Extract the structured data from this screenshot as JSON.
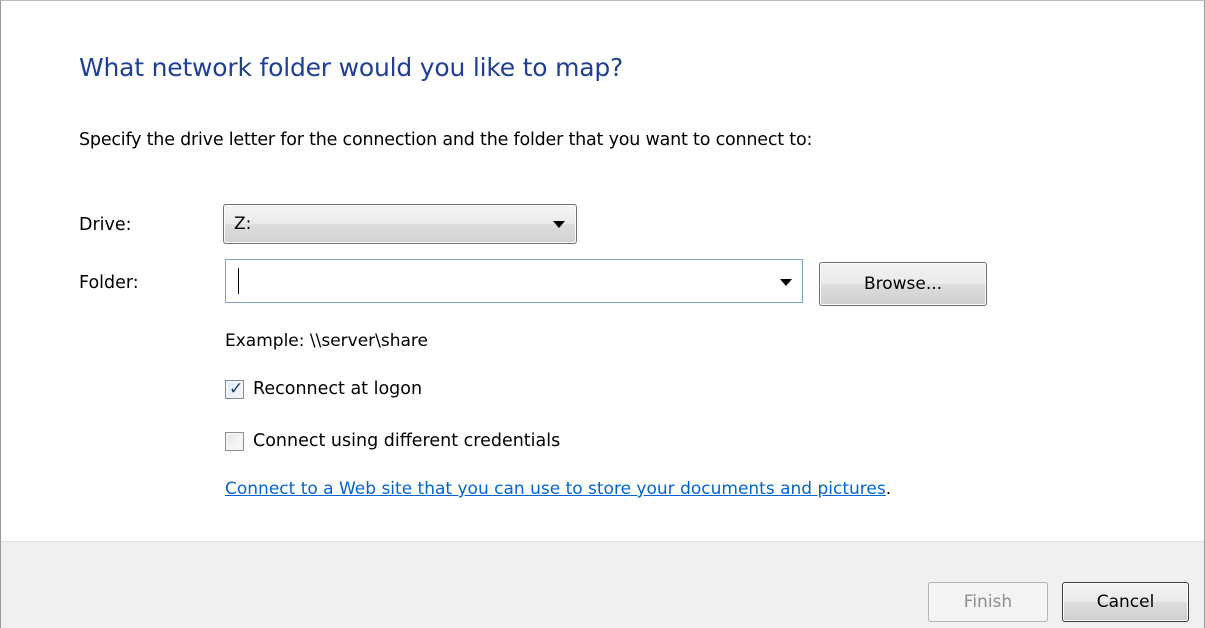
{
  "dialog": {
    "heading": "What network folder would you like to map?",
    "instruction": "Specify the drive letter for the connection and the folder that you want to connect to:"
  },
  "drive": {
    "label": "Drive:",
    "selected": "Z:",
    "icon": "chevron-down-icon"
  },
  "folder": {
    "label": "Folder:",
    "value": "",
    "browse_label": "Browse...",
    "example": "Example: \\\\server\\share"
  },
  "options": {
    "reconnect": {
      "label": "Reconnect at logon",
      "checked": true
    },
    "credentials": {
      "label": "Connect using different credentials",
      "checked": false
    }
  },
  "web_link": {
    "text": "Connect to a Web site that you can use to store your documents and pictures",
    "suffix": "."
  },
  "footer": {
    "finish_label": "Finish",
    "finish_enabled": false,
    "cancel_label": "Cancel"
  },
  "colors": {
    "heading": "#1e3f94",
    "link": "#0066cc",
    "footer_bg": "#f0f0f0",
    "disabled_text": "#8d8d8d"
  }
}
